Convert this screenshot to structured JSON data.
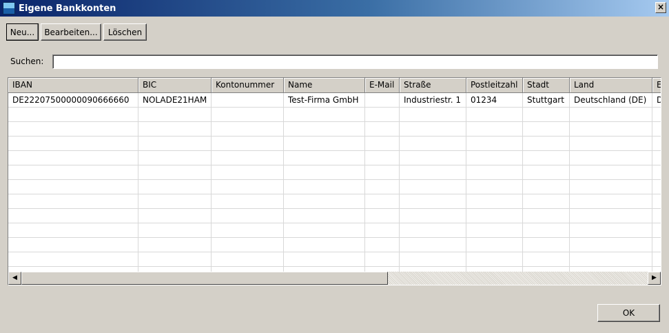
{
  "window": {
    "title": "Eigene Bankkonten",
    "close_glyph": "×"
  },
  "toolbar": {
    "new_label": "Neu...",
    "edit_label": "Bearbeiten...",
    "delete_label": "Löschen"
  },
  "search": {
    "label": "Suchen:",
    "value": ""
  },
  "table": {
    "columns": [
      "IBAN",
      "BIC",
      "Kontonummer",
      "Name",
      "E-Mail",
      "Straße",
      "Postleitzahl",
      "Stadt",
      "Land",
      "E"
    ],
    "rows": [
      [
        "DE22207500000090666660",
        "NOLADE21HAM",
        "",
        "Test-Firma GmbH",
        "",
        "Industriestr. 1",
        "01234",
        "Stuttgart",
        "Deutschland (DE)",
        "D"
      ]
    ],
    "empty_rows": 12
  },
  "scrollbar": {
    "left_arrow": "◀",
    "right_arrow": "▶"
  },
  "footer": {
    "ok_label": "OK"
  }
}
